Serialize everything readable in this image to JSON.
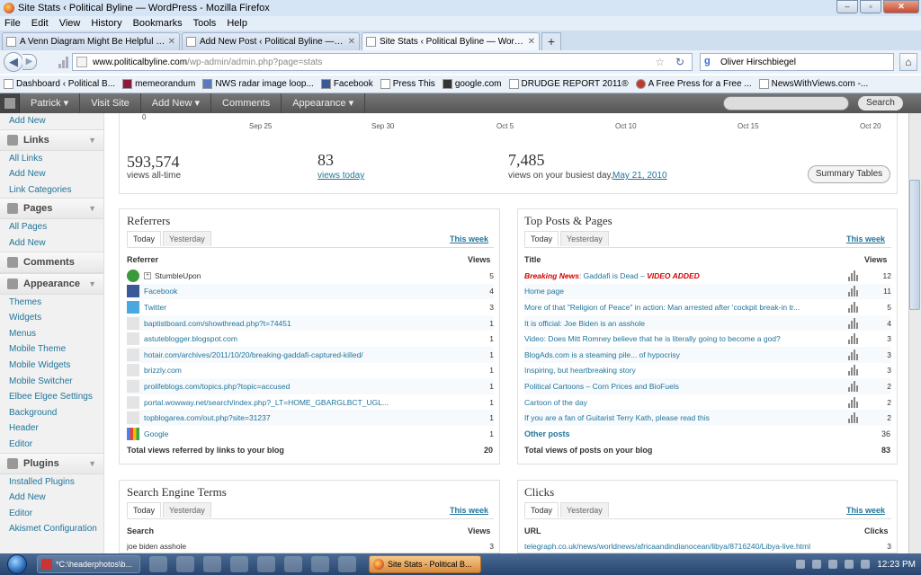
{
  "window": {
    "title": "Site Stats ‹ Political Byline — WordPress - Mozilla Firefox"
  },
  "menu": [
    "File",
    "Edit",
    "View",
    "History",
    "Bookmarks",
    "Tools",
    "Help"
  ],
  "tabs": [
    {
      "label": "A Venn Diagram Might Be Helpful : T..."
    },
    {
      "label": "Add New Post ‹ Political Byline — Wo..."
    },
    {
      "label": "Site Stats ‹ Political Byline — WordPre..."
    }
  ],
  "url": {
    "host": "www.politicalbyline.com",
    "path": "/wp-admin/admin.php?page=stats"
  },
  "search": {
    "value": "Oliver Hirschbiegel"
  },
  "bookmarks": [
    "Dashboard ‹ Political B...",
    "memeorandum",
    "NWS radar image loop...",
    "Facebook",
    "Press This",
    "google.com",
    "DRUDGE REPORT 2011®",
    "A Free Press for a Free ...",
    "NewsWithViews.com -..."
  ],
  "adminbar": {
    "items": [
      "Patrick ▾",
      "Visit Site",
      "Add New ▾",
      "Comments",
      "Appearance ▾"
    ],
    "search_btn": "Search"
  },
  "sidebar": {
    "top_link": "Add New",
    "links": {
      "title": "Links",
      "items": [
        "All Links",
        "Add New",
        "Link Categories"
      ]
    },
    "pages": {
      "title": "Pages",
      "items": [
        "All Pages",
        "Add New"
      ]
    },
    "comments": {
      "title": "Comments"
    },
    "appearance": {
      "title": "Appearance",
      "items": [
        "Themes",
        "Widgets",
        "Menus",
        "Mobile Theme",
        "Mobile Widgets",
        "Mobile Switcher",
        "Elbee Elgee Settings",
        "Background",
        "Header",
        "Editor"
      ]
    },
    "plugins": {
      "title": "Plugins",
      "items": [
        "Installed Plugins",
        "Add New",
        "Editor",
        "Akismet Configuration"
      ]
    }
  },
  "chart": {
    "dates": [
      "Sep 25",
      "Sep 30",
      "Oct 5",
      "Oct 10",
      "Oct 15",
      "Oct 20"
    ],
    "axis_zero": "0"
  },
  "stats": {
    "alltime": {
      "value": "593,574",
      "label": "views all-time"
    },
    "today": {
      "value": "83",
      "label": "views today"
    },
    "busiest": {
      "value": "7,485",
      "label": "views on your busiest day,",
      "date": "May 21, 2010"
    },
    "summary_btn": "Summary Tables"
  },
  "referrers": {
    "title": "Referrers",
    "tab_today": "Today",
    "tab_yesterday": "Yesterday",
    "this_week": "This week",
    "col1": "Referrer",
    "col2": "Views",
    "rows": [
      {
        "name": "StumbleUpon",
        "views": "5"
      },
      {
        "name": "Facebook",
        "views": "4"
      },
      {
        "name": "Twitter",
        "views": "3"
      },
      {
        "name": "baptistboard.com/showthread.php?t=74451",
        "views": "1"
      },
      {
        "name": "astuteblogger.blogspot.com",
        "views": "1"
      },
      {
        "name": "hotair.com/archives/2011/10/20/breaking-gaddafi-captured-killed/",
        "views": "1"
      },
      {
        "name": "brizzly.com",
        "views": "1"
      },
      {
        "name": "prolifeblogs.com/topics.php?topic=accused",
        "views": "1"
      },
      {
        "name": "portal.wowway.net/search/index.php?_LT=HOME_GBARGLBCT_UGL...",
        "views": "1"
      },
      {
        "name": "topblogarea.com/out.php?site=31237",
        "views": "1"
      },
      {
        "name": "Google",
        "views": "1"
      }
    ],
    "total_label": "Total views referred by links to your blog",
    "total": "20"
  },
  "toposts": {
    "title": "Top Posts & Pages",
    "tab_today": "Today",
    "tab_yesterday": "Yesterday",
    "this_week": "This week",
    "col1": "Title",
    "col2": "Views",
    "first": {
      "breaking": "Breaking News",
      "mid": ": Gaddafi is Dead – ",
      "video": "VIDEO ADDED",
      "views": "12"
    },
    "rows": [
      {
        "name": "Home page",
        "views": "11"
      },
      {
        "name": "More of that \"Religion of Peace\" in action: Man arrested after 'cockpit break-in tr...",
        "views": "5"
      },
      {
        "name": "It is official: Joe Biden is an asshole",
        "views": "4"
      },
      {
        "name": "Video: Does Mitt Romney believe that he is literally going to become a god?",
        "views": "3"
      },
      {
        "name": "BlogAds.com is a steaming pile... of hypocrisy",
        "views": "3"
      },
      {
        "name": "Inspiring, but heartbreaking story",
        "views": "3"
      },
      {
        "name": "Political Cartoons – Corn Prices and BioFuels",
        "views": "2"
      },
      {
        "name": "Cartoon of the day",
        "views": "2"
      },
      {
        "name": "If you are a fan of Guitarist Terry Kath, please read this",
        "views": "2"
      }
    ],
    "other_label": "Other posts",
    "other": "36",
    "total_label": "Total views of posts on your blog",
    "total": "83"
  },
  "searchterms": {
    "title": "Search Engine Terms",
    "tab_today": "Today",
    "tab_yesterday": "Yesterday",
    "this_week": "This week",
    "col1": "Search",
    "col2": "Views",
    "rows": [
      {
        "name": "joe biden asshole",
        "views": "3"
      }
    ]
  },
  "clicks": {
    "title": "Clicks",
    "tab_today": "Today",
    "tab_yesterday": "Yesterday",
    "this_week": "This week",
    "col1": "URL",
    "col2": "Clicks",
    "rows": [
      {
        "name": "telegraph.co.uk/news/worldnews/africaandindianocean/libya/8716240/Libya-live.html",
        "views": "3"
      }
    ]
  },
  "taskbar": {
    "items": [
      "*C:\\headerphotos\\b...",
      "Site Stats - Political B..."
    ],
    "time": "12:23 PM"
  }
}
